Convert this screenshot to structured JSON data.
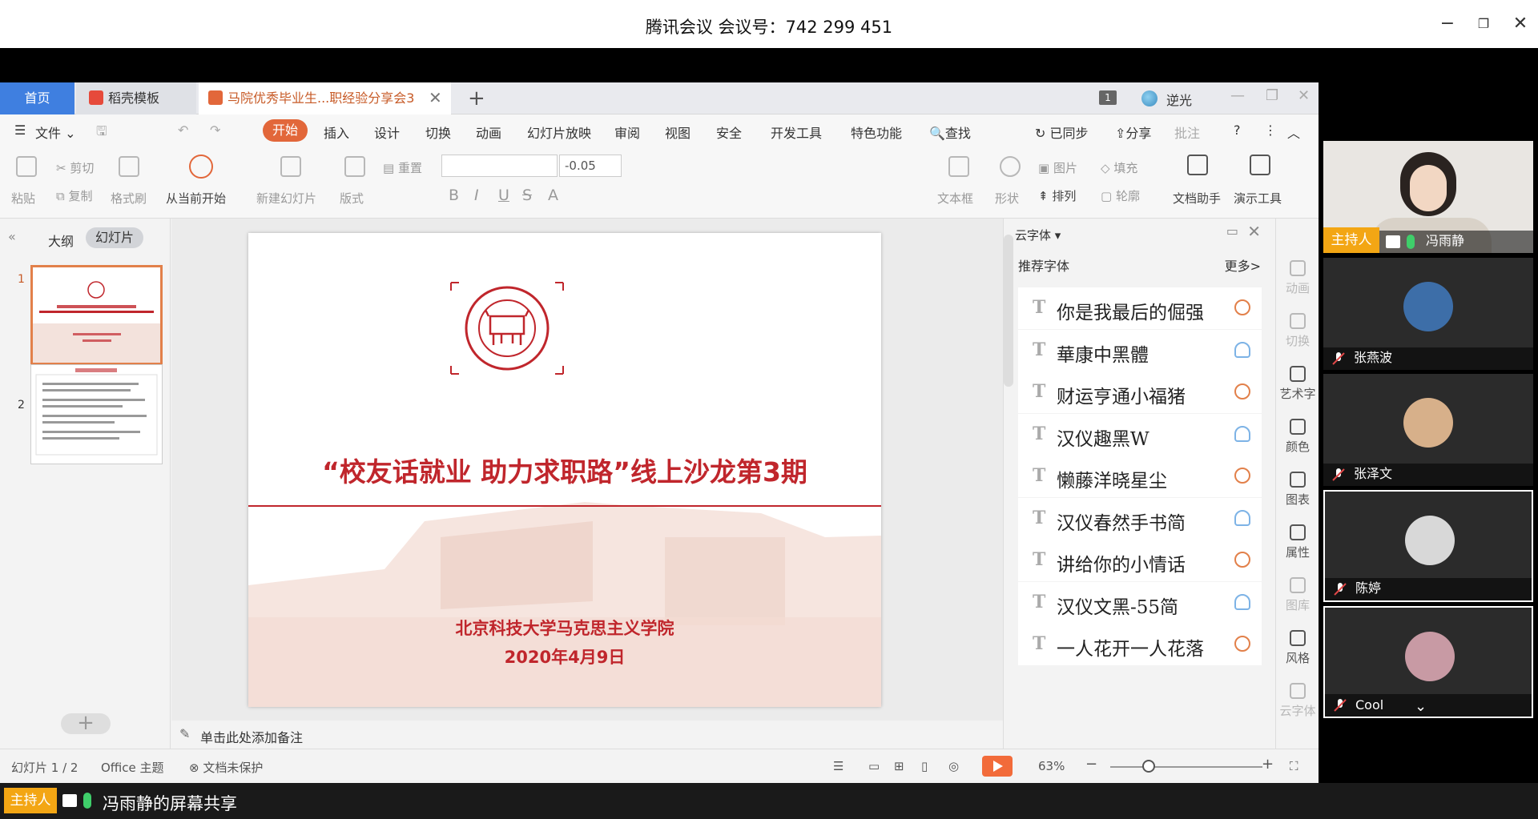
{
  "meeting": {
    "title": "腾讯会议 会议号：742 299 451"
  },
  "wps": {
    "tabs": {
      "home": "首页",
      "template": "稻壳模板",
      "document": "马院优秀毕业生...职经验分享会3"
    },
    "page_badge": "1",
    "user_name": "逆光",
    "menu": {
      "file": "文件",
      "start": "开始",
      "insert": "插入",
      "design": "设计",
      "transition": "切换",
      "animation": "动画",
      "slideshow": "幻灯片放映",
      "review": "审阅",
      "view": "视图",
      "security": "安全",
      "devtools": "开发工具",
      "special": "特色功能",
      "search": "查找",
      "synced": "已同步",
      "share": "分享",
      "comment": "批注"
    },
    "ribbon": {
      "paste": "粘贴",
      "cut": "剪切",
      "copy": "复制",
      "format_painter": "格式刷",
      "from_current": "从当前开始",
      "new_slide": "新建幻灯片",
      "layout": "版式",
      "reset": "重置",
      "font_size": "-0.05",
      "textbox": "文本框",
      "shape": "形状",
      "picture": "图片",
      "fill": "填充",
      "arrange": "排列",
      "outline": "轮廓",
      "doc_assistant": "文档助手",
      "presentation_tools": "演示工具"
    },
    "left_panel": {
      "outline_tab": "大纲",
      "slides_tab": "幻灯片",
      "slide_numbers": [
        "1",
        "2"
      ]
    },
    "slide": {
      "title": "“校友话就业   助力求职路”线上沙龙第3期",
      "org": "北京科技大学马克思主义学院",
      "date": "2020年4月9日"
    },
    "notes_placeholder": "单击此处添加备注",
    "font_panel": {
      "title": "云字体",
      "recommended": "推荐字体",
      "more": "更多>",
      "fonts": [
        {
          "name": "你是我最后的倔强",
          "status": "orange"
        },
        {
          "name": "華康中黑體",
          "status": "blue"
        },
        {
          "name": "财运亨通小福猪",
          "status": "orange"
        },
        {
          "name": "汉仪趣黑W",
          "status": "blue"
        },
        {
          "name": "懒藤洋晓星尘",
          "status": "orange"
        },
        {
          "name": "汉仪春然手书简",
          "status": "blue"
        },
        {
          "name": "讲给你的小情话",
          "status": "orange"
        },
        {
          "name": "汉仪文黑-55简",
          "status": "blue"
        },
        {
          "name": "一人花开一人花落",
          "status": "orange"
        }
      ]
    },
    "rail": {
      "animation": "动画",
      "transition": "切换",
      "art_text": "艺术字",
      "color": "颜色",
      "chart": "图表",
      "properties": "属性",
      "gallery": "图库",
      "style": "风格",
      "cloud_font": "云字体"
    },
    "status": {
      "slide_count": "幻灯片 1 / 2",
      "theme": "Office 主题",
      "protection": "文档未保护",
      "zoom": "63%"
    }
  },
  "participants": {
    "host_label": "主持人",
    "people": [
      {
        "name": "冯雨静",
        "role": "host"
      },
      {
        "name": "张燕波"
      },
      {
        "name": "张泽文"
      },
      {
        "name": "陈婷"
      },
      {
        "name": "Cool"
      }
    ]
  },
  "share_bar": {
    "host_label": "主持人",
    "text": "冯雨静的屏幕共享"
  },
  "colors": {
    "accent_orange": "#e2673a",
    "slide_red": "#c0262c",
    "host_yellow": "#f3a614",
    "tab_blue": "#3f7fe0"
  }
}
